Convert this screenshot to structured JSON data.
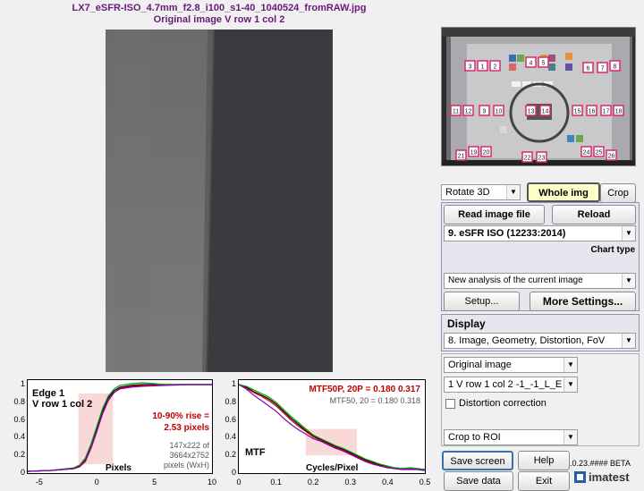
{
  "header": {
    "filename": "LX7_eSFR-ISO_4.7mm_f2.8_i100_s1-40_1040524_fromRAW.jpg",
    "subtitle": "Original image   V row 1 col 2"
  },
  "thumbnail": {
    "roi_numbers": [
      "3",
      "1",
      "2",
      "4",
      "5",
      "6",
      "7",
      "8",
      "11",
      "12",
      "9",
      "10",
      "13",
      "14",
      "15",
      "16",
      "17",
      "18",
      "21",
      "19",
      "20",
      "22",
      "23",
      "24",
      "25",
      "26"
    ]
  },
  "controls": {
    "rotate_select": "Rotate 3D",
    "whole_img_button": "Whole img",
    "crop_button": "Crop",
    "read_image_button": "Read image file",
    "reload_button": "Reload",
    "chart_select": "9. eSFR ISO  (12233:2014)",
    "chart_type_label": "Chart type",
    "analysis_select": "New analysis of the current image",
    "setup_button": "Setup...",
    "more_settings_button": "More Settings...",
    "display_label": "Display",
    "display_select": "8.  Image, Geometry, Distortion, FoV",
    "image_select": "Original image",
    "roi_select": "1  V row 1 col 2   -1_-1_L_E",
    "distortion_label": "Distortion correction",
    "crop_select": "Crop to ROI",
    "save_screen_button": "Save screen",
    "help_button": "Help",
    "version_text": ".0.23.#### BETA",
    "save_data_button": "Save data",
    "exit_button": "Exit",
    "brand": "imatest"
  },
  "edge_plot": {
    "title1": "Edge 1",
    "title2": "V row 1 col 2",
    "rise_label1": "10-90% rise =",
    "rise_label2": "2.53 pixels",
    "size1": "147x222 of",
    "size2": "3664x2752",
    "size3": "pixels (WxH)",
    "xlabel": "Pixels"
  },
  "mtf_plot": {
    "title": "MTF",
    "mtf50p_label": "MTF50P, 20P = 0.180  0.317",
    "mtf50_label": "MTF50, 20  =  0.180  0.318",
    "xlabel": "Cycles/Pixel"
  },
  "chart_data": [
    {
      "type": "line",
      "title": "Edge 1",
      "xlabel": "Pixels",
      "xlim": [
        -6,
        10
      ],
      "ylim": [
        0,
        1.05
      ],
      "x_ticks": [
        "-5",
        "0",
        "5",
        "10"
      ],
      "y_ticks": [
        "0",
        "0.2",
        "0.4",
        "0.6",
        "0.8",
        "1"
      ],
      "rise_10_90_pixels": 2.53,
      "series": [
        {
          "color": "#000000",
          "x": [
            -6,
            -4,
            -2,
            -1.5,
            -1,
            -0.5,
            0,
            0.5,
            1,
            1.5,
            2,
            3,
            4,
            6,
            8,
            10
          ],
          "y": [
            0.02,
            0.03,
            0.05,
            0.08,
            0.15,
            0.3,
            0.5,
            0.7,
            0.85,
            0.93,
            0.97,
            0.99,
            1.0,
            1.0,
            1.0,
            1.0
          ]
        },
        {
          "color": "#d00000",
          "x": [
            -6,
            -4,
            -2,
            -1.5,
            -1,
            -0.5,
            0,
            0.5,
            1,
            1.5,
            2,
            3,
            4,
            6,
            8,
            10
          ],
          "y": [
            0.02,
            0.03,
            0.05,
            0.07,
            0.13,
            0.28,
            0.47,
            0.67,
            0.82,
            0.91,
            0.96,
            0.98,
            0.99,
            1.0,
            1.0,
            1.0
          ]
        },
        {
          "color": "#00a000",
          "x": [
            -6,
            -4,
            -2,
            -1.5,
            -1,
            -0.5,
            0,
            0.5,
            1,
            1.5,
            2,
            3,
            4,
            6,
            8,
            10
          ],
          "y": [
            0.02,
            0.03,
            0.06,
            0.09,
            0.17,
            0.33,
            0.53,
            0.73,
            0.87,
            0.95,
            0.99,
            1.01,
            1.02,
            1.0,
            1.0,
            1.0
          ]
        },
        {
          "color": "#8000c0",
          "x": [
            -6,
            -4,
            -2,
            -1.5,
            -1,
            -0.5,
            0,
            0.5,
            1,
            1.5,
            2,
            3,
            4,
            6,
            8,
            10
          ],
          "y": [
            0.02,
            0.03,
            0.05,
            0.08,
            0.14,
            0.29,
            0.48,
            0.68,
            0.83,
            0.91,
            0.95,
            0.97,
            0.98,
            0.99,
            1.0,
            1.0
          ]
        }
      ]
    },
    {
      "type": "line",
      "title": "MTF",
      "xlabel": "Cycles/Pixel",
      "xlim": [
        0,
        0.5
      ],
      "ylim": [
        0,
        1.05
      ],
      "x_ticks": [
        "0",
        "0.1",
        "0.2",
        "0.3",
        "0.4",
        "0.5"
      ],
      "y_ticks": [
        "0",
        "0.2",
        "0.4",
        "0.6",
        "0.8",
        "1"
      ],
      "mtf50p": 0.18,
      "mtf20p": 0.317,
      "mtf50": 0.18,
      "mtf20": 0.318,
      "series": [
        {
          "color": "#000000",
          "x": [
            0,
            0.02,
            0.04,
            0.06,
            0.08,
            0.1,
            0.12,
            0.14,
            0.16,
            0.18,
            0.2,
            0.22,
            0.24,
            0.26,
            0.28,
            0.3,
            0.32,
            0.34,
            0.36,
            0.38,
            0.4,
            0.42,
            0.44,
            0.46,
            0.48,
            0.5
          ],
          "y": [
            1.0,
            0.97,
            0.92,
            0.88,
            0.84,
            0.78,
            0.7,
            0.62,
            0.55,
            0.48,
            0.42,
            0.38,
            0.34,
            0.3,
            0.27,
            0.23,
            0.19,
            0.15,
            0.12,
            0.09,
            0.07,
            0.06,
            0.05,
            0.06,
            0.05,
            0.04
          ]
        },
        {
          "color": "#d00000",
          "x": [
            0,
            0.02,
            0.04,
            0.06,
            0.08,
            0.1,
            0.12,
            0.14,
            0.16,
            0.18,
            0.2,
            0.22,
            0.24,
            0.26,
            0.28,
            0.3,
            0.32,
            0.34,
            0.36,
            0.38,
            0.4,
            0.42,
            0.44,
            0.46,
            0.48,
            0.5
          ],
          "y": [
            1.0,
            0.96,
            0.91,
            0.87,
            0.82,
            0.76,
            0.68,
            0.6,
            0.53,
            0.47,
            0.41,
            0.37,
            0.33,
            0.29,
            0.26,
            0.22,
            0.18,
            0.14,
            0.11,
            0.08,
            0.07,
            0.05,
            0.04,
            0.05,
            0.04,
            0.03
          ]
        },
        {
          "color": "#00a000",
          "x": [
            0,
            0.02,
            0.04,
            0.06,
            0.08,
            0.1,
            0.12,
            0.14,
            0.16,
            0.18,
            0.2,
            0.22,
            0.24,
            0.26,
            0.28,
            0.3,
            0.32,
            0.34,
            0.36,
            0.38,
            0.4,
            0.42,
            0.44,
            0.46,
            0.48,
            0.5
          ],
          "y": [
            1.0,
            0.98,
            0.94,
            0.9,
            0.86,
            0.8,
            0.72,
            0.64,
            0.57,
            0.5,
            0.43,
            0.39,
            0.35,
            0.31,
            0.28,
            0.24,
            0.2,
            0.16,
            0.13,
            0.1,
            0.08,
            0.06,
            0.05,
            0.06,
            0.05,
            0.04
          ]
        },
        {
          "color": "#8000c0",
          "x": [
            0,
            0.02,
            0.04,
            0.06,
            0.08,
            0.1,
            0.12,
            0.14,
            0.16,
            0.18,
            0.2,
            0.22,
            0.24,
            0.26,
            0.28,
            0.3,
            0.32,
            0.34,
            0.36,
            0.38,
            0.4,
            0.42,
            0.44,
            0.46,
            0.48,
            0.5
          ],
          "y": [
            1.0,
            0.95,
            0.88,
            0.82,
            0.76,
            0.7,
            0.62,
            0.55,
            0.49,
            0.44,
            0.39,
            0.36,
            0.32,
            0.28,
            0.25,
            0.21,
            0.17,
            0.13,
            0.1,
            0.08,
            0.06,
            0.05,
            0.04,
            0.04,
            0.04,
            0.03
          ]
        }
      ]
    }
  ]
}
